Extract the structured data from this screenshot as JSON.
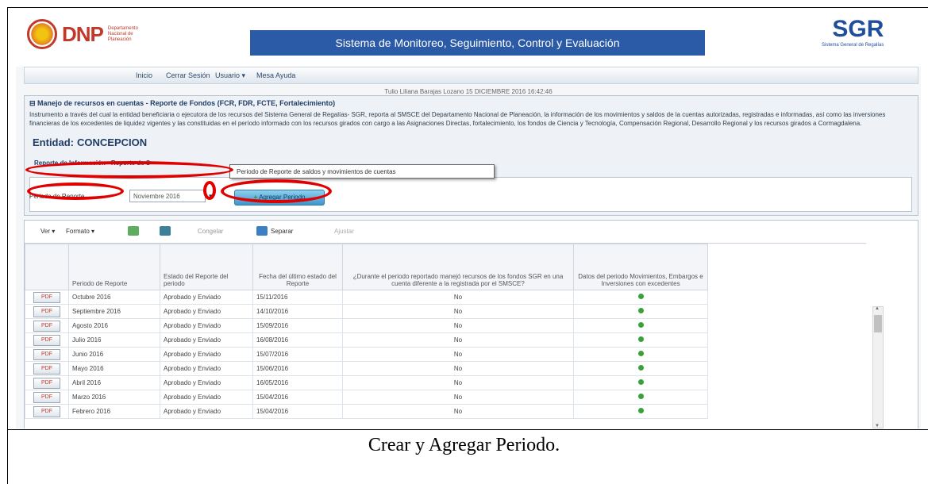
{
  "header": {
    "dnp_logo": "DNP",
    "dnp_subtitle": "Departamento Nacional de Planeación",
    "system_title": "Sistema de Monitoreo, Seguimiento, Control y Evaluación",
    "sgr_logo": "SGR",
    "sgr_subtitle": "Sistema General de Regalías"
  },
  "nav": {
    "items": [
      "Inicio",
      "Cerrar Sesión",
      "Usuario ▾",
      "Mesa Ayuda"
    ]
  },
  "user_line": "Tulio Liliana Barajas Lozano 15 DICIEMBRE 2016 16:42:46",
  "panel": {
    "title": "Manejo de recursos en cuentas - Reporte de Fondos (FCR, FDR, FCTE, Fortalecimiento)",
    "description": "Instrumento a través del cual la entidad beneficiaria o ejecutora de los recursos del Sistema General de Regalías- SGR, reporta al SMSCE del Departamento Nacional de Planeación, la información de los movimientos y saldos de la cuentas autorizadas, registradas e informadas, así como las inversiones financieras de los excedentes de liquidez vigentes y las constituidas en el período informado con los recursos girados con cargo a las Asignaciones Directas, fortalecimiento, los fondos de Ciencia y Tecnología, Compensación Regional, Desarrollo Regional y los recursos girados a Cormagdalena.",
    "entity_label": "Entidad:",
    "entity_value": "CONCEPCION",
    "report_label": "Reporte de Información - Reporte de S",
    "tooltip": "Periodo de Reporte de saldos y movimientos de cuentas",
    "periodo_label": "Periodo de Reporte",
    "periodo_value": "Noviembre 2016",
    "agregar_label": "Agregar Periodo"
  },
  "toolbar": {
    "ver": "Ver ▾",
    "formato": "Formato ▾",
    "congelar": "Congelar",
    "separar": "Separar",
    "ajustar": "Ajustar"
  },
  "table": {
    "headers": [
      "",
      "Periodo de Reporte",
      "Estado del Reporte del periodo",
      "Fecha del último estado del Reporte",
      "¿Durante el periodo reportado manejó recursos de los fondos SGR en una cuenta diferente a la registrada por el SMSCE?",
      "Datos del periodo Movimientos, Embargos e Inversiones con excedentes"
    ],
    "pdf_label": "PDF",
    "rows": [
      {
        "periodo": "Octubre 2016",
        "estado": "Aprobado y Enviado",
        "fecha": "15/11/2016",
        "respuesta": "No"
      },
      {
        "periodo": "Septiembre 2016",
        "estado": "Aprobado y Enviado",
        "fecha": "14/10/2016",
        "respuesta": "No"
      },
      {
        "periodo": "Agosto 2016",
        "estado": "Aprobado y Enviado",
        "fecha": "15/09/2016",
        "respuesta": "No"
      },
      {
        "periodo": "Julio 2016",
        "estado": "Aprobado y Enviado",
        "fecha": "16/08/2016",
        "respuesta": "No"
      },
      {
        "periodo": "Junio 2016",
        "estado": "Aprobado y Enviado",
        "fecha": "15/07/2016",
        "respuesta": "No"
      },
      {
        "periodo": "Mayo 2016",
        "estado": "Aprobado y Enviado",
        "fecha": "15/06/2016",
        "respuesta": "No"
      },
      {
        "periodo": "Abril 2016",
        "estado": "Aprobado y Enviado",
        "fecha": "16/05/2016",
        "respuesta": "No"
      },
      {
        "periodo": "Marzo 2016",
        "estado": "Aprobado y Enviado",
        "fecha": "15/04/2016",
        "respuesta": "No"
      },
      {
        "periodo": "Febrero 2016",
        "estado": "Aprobado y Enviado",
        "fecha": "15/04/2016",
        "respuesta": "No"
      }
    ]
  },
  "caption": "Crear y Agregar Periodo.",
  "colors": {
    "title_bar": "#2b5aa6",
    "highlight_ring": "#e00000",
    "dnp_red": "#c0392b",
    "sgr_blue": "#1f4e9a"
  }
}
